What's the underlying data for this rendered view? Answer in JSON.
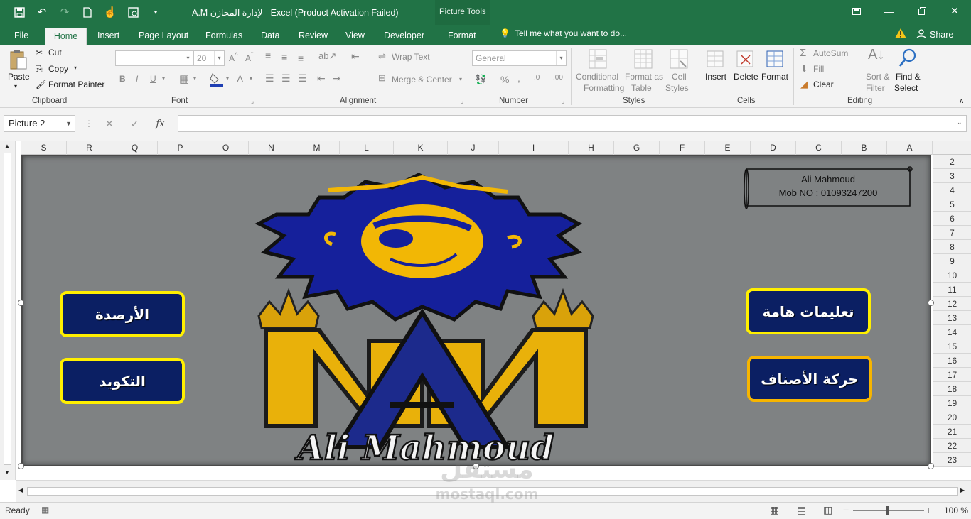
{
  "app": {
    "title": "A.M لإدارة المخازن - Excel (Product Activation Failed)",
    "context_tab_group": "Picture Tools",
    "window_controls": [
      "ribbon-display-icon",
      "minimize-icon",
      "restore-icon",
      "close-icon"
    ],
    "accent_color": "#217346"
  },
  "quick_access": [
    "save-icon",
    "undo-icon",
    "redo-icon",
    "new-icon",
    "touch-mode-icon",
    "print-preview-icon",
    "customize-icon"
  ],
  "tabs": {
    "file": "File",
    "home": "Home",
    "insert": "Insert",
    "page_layout": "Page Layout",
    "formulas": "Formulas",
    "data": "Data",
    "review": "Review",
    "view": "View",
    "developer": "Developer",
    "format": "Format",
    "tell_me": "Tell me what you want to do...",
    "share": "Share"
  },
  "ribbon": {
    "clipboard": {
      "paste": "Paste",
      "cut": "Cut",
      "copy": "Copy",
      "format_painter": "Format Painter",
      "label": "Clipboard"
    },
    "font": {
      "name": "",
      "size": "20",
      "label": "Font"
    },
    "alignment": {
      "wrap_text": "Wrap Text",
      "merge_center": "Merge & Center",
      "label": "Alignment"
    },
    "number": {
      "format": "General",
      "label": "Number"
    },
    "styles": {
      "conditional": "Conditional",
      "conditional2": "Formatting",
      "format_as": "Format as",
      "format_as2": "Table",
      "cell": "Cell",
      "cell2": "Styles",
      "label": "Styles"
    },
    "cells": {
      "insert": "Insert",
      "delete": "Delete",
      "format": "Format",
      "label": "Cells"
    },
    "editing": {
      "autosum": "AutoSum",
      "fill": "Fill",
      "clear": "Clear",
      "sort": "Sort &",
      "sort2": "Filter",
      "find": "Find &",
      "find2": "Select",
      "label": "Editing"
    }
  },
  "formula_bar": {
    "name_box": "Picture 2",
    "formula": ""
  },
  "columns": [
    "S",
    "R",
    "Q",
    "P",
    "O",
    "N",
    "M",
    "L",
    "K",
    "J",
    "I",
    "H",
    "G",
    "F",
    "E",
    "D",
    "C",
    "B",
    "A"
  ],
  "rows": [
    "2",
    "3",
    "4",
    "5",
    "6",
    "7",
    "8",
    "9",
    "10",
    "11",
    "12",
    "13",
    "14",
    "15",
    "16",
    "17",
    "18",
    "19",
    "20",
    "21",
    "22",
    "23"
  ],
  "picture": {
    "note_line1": "Ali Mahmoud",
    "note_line2": "Mob NO : 01093247200",
    "logo_caption": "Ali Mahmoud",
    "logo_letters": "AM",
    "buttons": {
      "balances": "الأرصدة",
      "coding": "التكويد",
      "instructions": "تعليمات هامة",
      "item_movement": "حركة الأصناف"
    }
  },
  "status": {
    "ready": "Ready",
    "zoom": "100 %"
  },
  "watermark": {
    "arabic": "مستقل",
    "latin": "mostaql.com"
  }
}
